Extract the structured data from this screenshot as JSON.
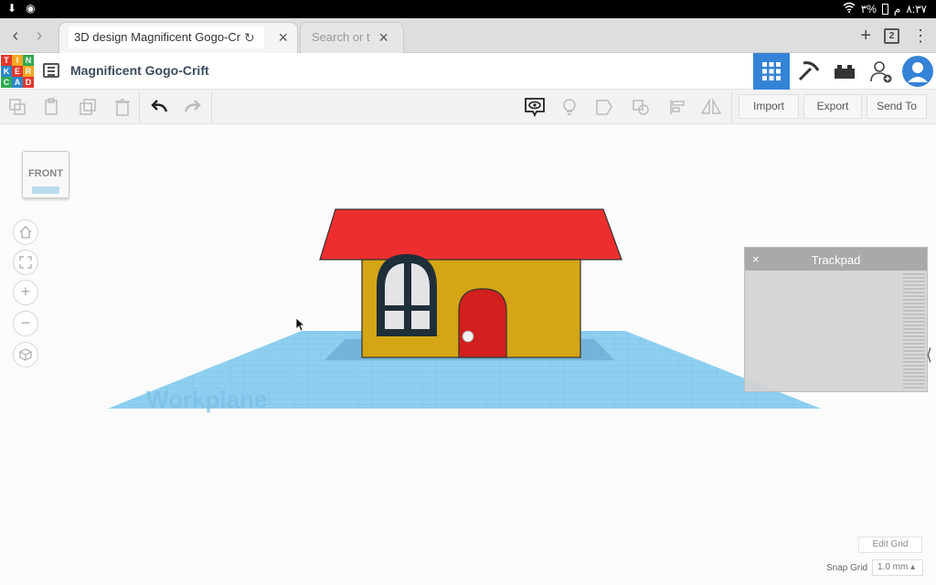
{
  "status_bar": {
    "time": "٨:٣٧",
    "meridiem": "م",
    "battery": "٣%"
  },
  "browser": {
    "active_tab_title": "3D design Magnificent Gogo-Cr",
    "inactive_tab_title": "Search or ty",
    "tab_count": "2"
  },
  "app": {
    "logo_letters": [
      "T",
      "I",
      "N",
      "K",
      "E",
      "R",
      "C",
      "A",
      "D"
    ],
    "logo_colors": [
      "#e2382b",
      "#f5a623",
      "#2eaa4f",
      "#2d86c9",
      "#e2382b",
      "#f5a623",
      "#2eaa4f",
      "#2d86c9",
      "#e2382b"
    ],
    "design_title": "Magnificent Gogo-Crift",
    "accent": "#3583d6"
  },
  "toolbar": {
    "import_label": "Import",
    "export_label": "Export",
    "send_to_label": "Send To"
  },
  "viewcube": {
    "face_label": "FRONT"
  },
  "workplane": {
    "watermark": "Workplane"
  },
  "trackpad": {
    "title": "Trackpad",
    "close_glyph": "×"
  },
  "grid": {
    "edit_label": "Edit Grid",
    "snap_label": "Snap Grid",
    "snap_value": "1.0 mm ▴"
  },
  "colors": {
    "roof": "#ee2e2e",
    "walls": "#d4a514",
    "door": "#d1201e",
    "window_frame": "#1f2f3a",
    "workplane": "#8ecff0"
  }
}
